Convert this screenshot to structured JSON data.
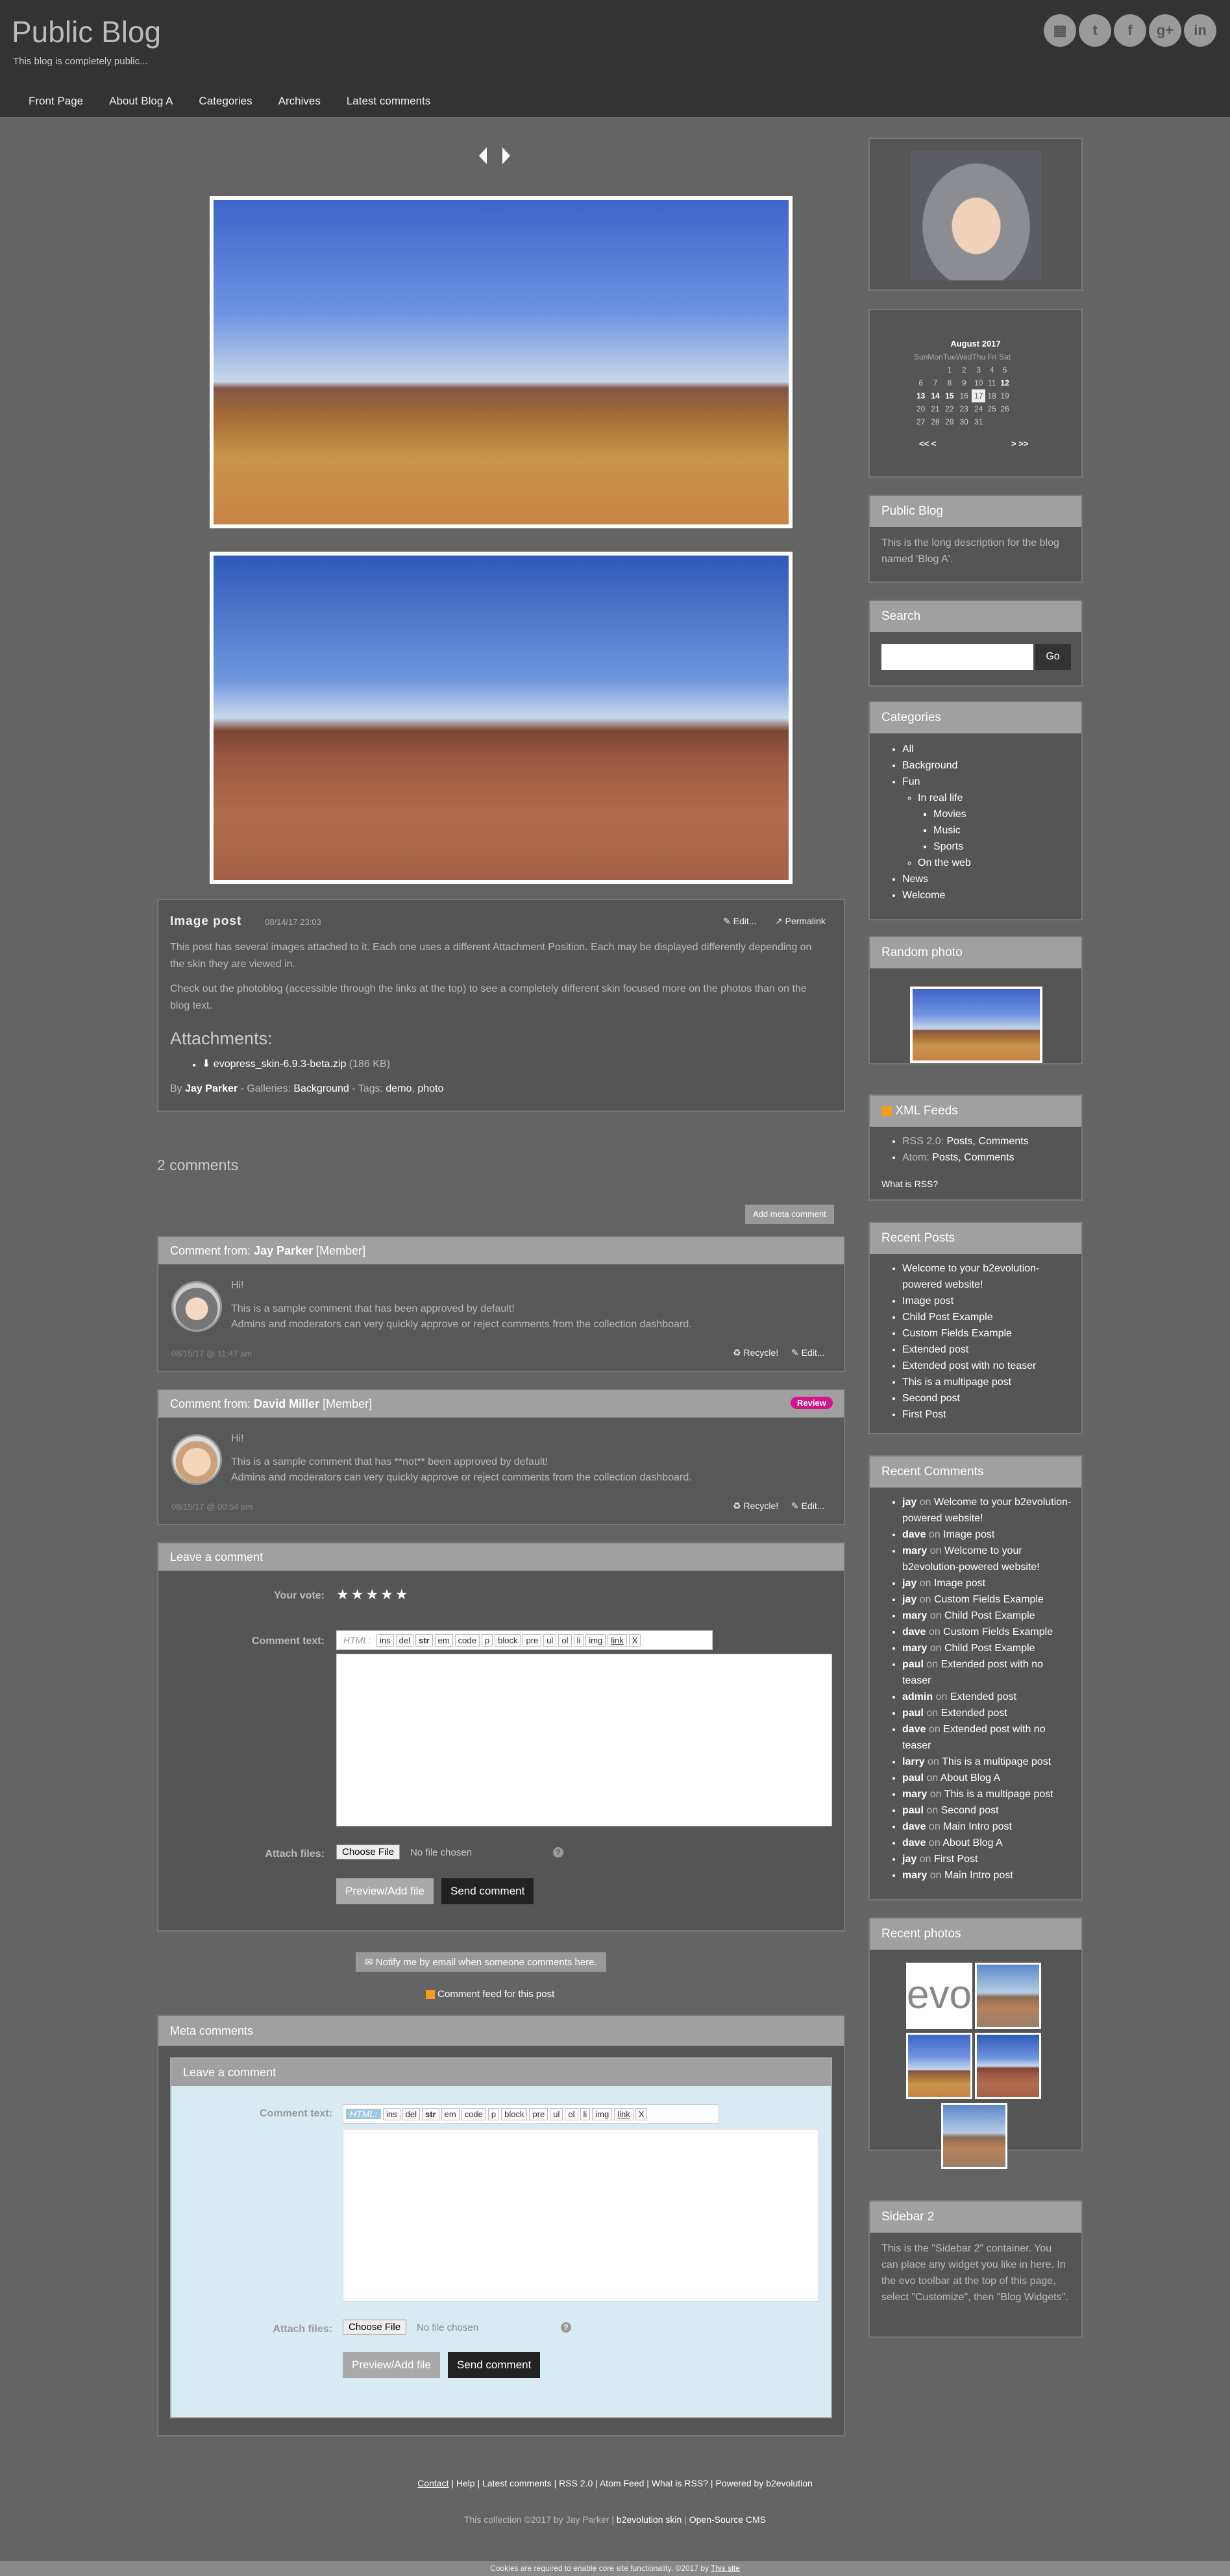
{
  "header": {
    "title": "Public Blog",
    "tagline": "This blog is completely public...",
    "social": [
      "▦",
      "t",
      "f",
      "g+",
      "in"
    ]
  },
  "nav": [
    "Front Page",
    "About Blog A",
    "Categories",
    "Archives",
    "Latest comments"
  ],
  "post": {
    "title": "Image post",
    "date": "08/14/17 23:03",
    "edit_label": "Edit...",
    "permalink_label": "Permalink",
    "para1": "This post has several images attached to it. Each one uses a different Attachment Position. Each may be displayed differently depending on the skin they are viewed in.",
    "para2": "Check out the photoblog (accessible through the links at the top) to see a completely different skin focused more on the photos than on the blog text.",
    "attachments_title": "Attachments:",
    "attachment_file": "evopress_skin-6.9.3-beta.zip",
    "attachment_size": "(186 KB)",
    "by_label": "By",
    "author": "Jay Parker",
    "galleries_label": "- Galleries:",
    "gallery": "Background",
    "tags_label": "- Tags:",
    "tag1": "demo",
    "tag2": "photo"
  },
  "comments": {
    "count_label": "2 comments",
    "add_meta_label": "Add meta comment",
    "items": [
      {
        "from_label": "Comment from:",
        "author": "Jay Parker",
        "role": "[Member]",
        "hi": "Hi!",
        "line1": "This is a sample comment that has been approved by default!",
        "line2": "Admins and moderators can very quickly approve or reject comments from the collection dashboard.",
        "date": "08/15/17 @ 11:47 am",
        "recycle": "Recycle!",
        "edit": "Edit..."
      },
      {
        "from_label": "Comment from:",
        "author": "David Miller",
        "role": "[Member]",
        "badge": "Review",
        "hi": "Hi!",
        "line1": "This is a sample comment that has **not** been approved by default!",
        "line2": "Admins and moderators can very quickly approve or reject comments from the collection dashboard.",
        "date": "08/15/17 @ 00:54 pm",
        "recycle": "Recycle!",
        "edit": "Edit..."
      }
    ]
  },
  "leave_comment": {
    "title": "Leave a comment",
    "vote_label": "Your vote:",
    "stars": "★★★★★",
    "text_label": "Comment text:",
    "toolbar": [
      "HTML:",
      "ins",
      "del",
      "str",
      "em",
      "code",
      "p",
      "block",
      "pre",
      "ul",
      "ol",
      "li",
      "img",
      "link",
      "X"
    ],
    "attach_label": "Attach files:",
    "choose_file": "Choose File",
    "no_file": "No file chosen",
    "help": "?",
    "preview_label": "Preview/Add file",
    "send_label": "Send comment"
  },
  "notify_label": "Notify me by email when someone comments here.",
  "feed_label": "Comment feed for this post",
  "meta_comments": {
    "title": "Meta comments",
    "leave_title": "Leave a comment",
    "text_label": "Comment text:",
    "toolbar": [
      "HTML:",
      "ins",
      "del",
      "str",
      "em",
      "code",
      "p",
      "block",
      "pre",
      "ul",
      "ol",
      "li",
      "img",
      "link",
      "X"
    ],
    "attach_label": "Attach files:",
    "choose_file": "Choose File",
    "no_file": "No file chosen",
    "help": "?",
    "preview_label": "Preview/Add file",
    "send_label": "Send comment"
  },
  "footer": {
    "links": [
      "Contact",
      "Help",
      "Latest comments",
      "RSS 2.0",
      "Atom Feed",
      "What is RSS?",
      "Powered by b2evolution"
    ],
    "collection": "This collection ©2017 by Jay Parker",
    "skin": "b2evolution skin",
    "cms": "Open-Source CMS",
    "cookies": "Cookies are required to enable core site functionality. ©2017 by",
    "cookies_link": "This site"
  },
  "sidebar": {
    "calendar": {
      "title": "August 2017",
      "days": [
        "Sun",
        "Mon",
        "Tue",
        "Wed",
        "Thu",
        "Fri",
        "Sat"
      ],
      "rows": [
        [
          "",
          "",
          "1",
          "2",
          "3",
          "4",
          "5"
        ],
        [
          "6",
          "7",
          "8",
          "9",
          "10",
          "11",
          "12"
        ],
        [
          "13",
          "14",
          "15",
          "16",
          "17",
          "18",
          "19"
        ],
        [
          "20",
          "21",
          "22",
          "23",
          "24",
          "25",
          "26"
        ],
        [
          "27",
          "28",
          "29",
          "30",
          "31",
          "",
          ""
        ]
      ],
      "nav_prev": "<<  <",
      "nav_next": ">  >>"
    },
    "public_blog": {
      "title": "Public Blog",
      "text": "This is the long description for the blog named 'Blog A'."
    },
    "search": {
      "title": "Search",
      "go": "Go"
    },
    "categories": {
      "title": "Categories",
      "items": [
        "All",
        "Background",
        "Fun",
        "In real life",
        "Movies",
        "Music",
        "Sports",
        "On the web",
        "News",
        "Welcome"
      ]
    },
    "random_photo": {
      "title": "Random photo"
    },
    "xml": {
      "title": "XML Feeds",
      "rss_label": "RSS 2.0:",
      "atom_label": "Atom:",
      "posts": "Posts",
      "comments": "Comments",
      "what": "What is RSS?"
    },
    "recent_posts": {
      "title": "Recent Posts",
      "items": [
        "Welcome to your b2evolution-powered website!",
        "Image post",
        "Child Post Example",
        "Custom Fields Example",
        "Extended post",
        "Extended post with no teaser",
        "This is a multipage post",
        "Second post",
        "First Post"
      ]
    },
    "recent_comments": {
      "title": "Recent Comments",
      "on": "on",
      "items": [
        [
          "jay",
          "Welcome to your b2evolution-powered website!"
        ],
        [
          "dave",
          "Image post"
        ],
        [
          "mary",
          "Welcome to your b2evolution-powered website!"
        ],
        [
          "jay",
          "Image post"
        ],
        [
          "jay",
          "Custom Fields Example"
        ],
        [
          "mary",
          "Child Post Example"
        ],
        [
          "dave",
          "Custom Fields Example"
        ],
        [
          "mary",
          "Child Post Example"
        ],
        [
          "paul",
          "Extended post with no teaser"
        ],
        [
          "admin",
          "Extended post"
        ],
        [
          "paul",
          "Extended post"
        ],
        [
          "dave",
          "Extended post with no teaser"
        ],
        [
          "larry",
          "This is a multipage post"
        ],
        [
          "paul",
          "About Blog A"
        ],
        [
          "mary",
          "This is a multipage post"
        ],
        [
          "paul",
          "Second post"
        ],
        [
          "dave",
          "Main Intro post"
        ],
        [
          "dave",
          "About Blog A"
        ],
        [
          "jay",
          "First Post"
        ],
        [
          "mary",
          "Main Intro post"
        ]
      ]
    },
    "recent_photos": {
      "title": "Recent photos",
      "evo_text": "evo"
    },
    "sidebar2": {
      "title": "Sidebar 2",
      "text": "This is the \"Sidebar 2\" container. You can place any widget you like in here. In the evo toolbar at the top of this page, select \"Customize\", then \"Blog Widgets\"."
    }
  }
}
